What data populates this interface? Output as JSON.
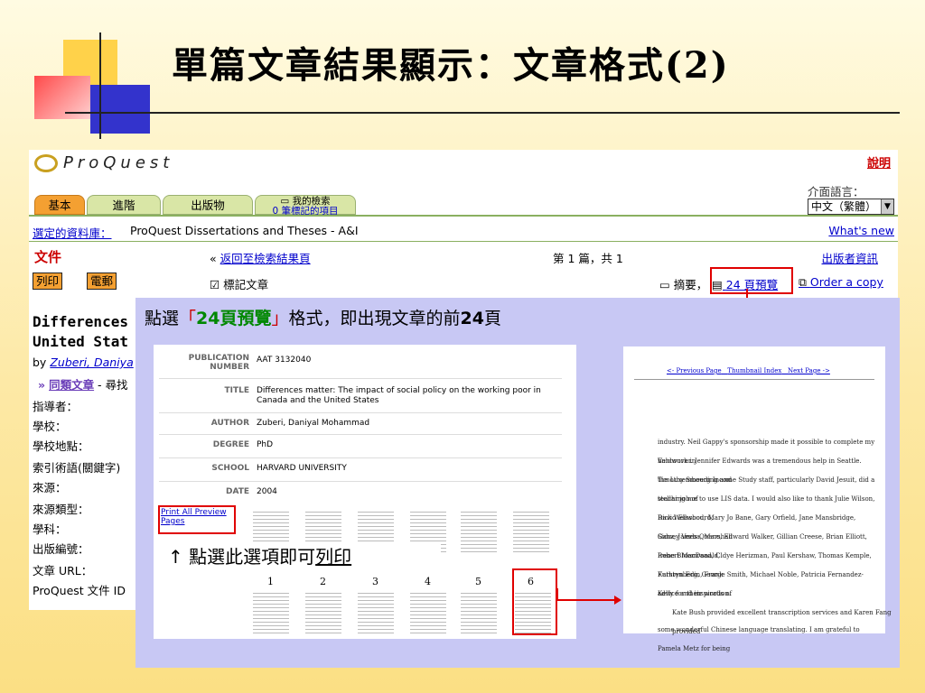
{
  "slide": {
    "title": "單篇文章結果顯示：文章格式(2)"
  },
  "proquest": {
    "logo": "ProQuest",
    "help": "說明",
    "lang_label": "介面語言：",
    "lang_value": "中文（繁體）",
    "tabs": [
      "基本",
      "進階",
      "出版物"
    ],
    "tab_mysearch": "我的檢索",
    "tab_marked": "0 筆標記的項目",
    "db_label": "選定的資料庫：",
    "db_name": "ProQuest Dissertations and Theses - A&I",
    "whats_new": "What's new",
    "doc_heading": "文件",
    "back_prefix": "«",
    "back_link": "返回至檢索結果頁",
    "page_count": "第 1 篇，共 1",
    "publisher_info": "出版者資訊",
    "print_btn": "列印",
    "email_btn": "電郵",
    "mark_article": "☑ 標記文章",
    "fmt_abstract": "摘要，",
    "fmt_24": "24 頁預覽",
    "fmt_order": "Order a copy",
    "article_title_1": "Differences",
    "article_title_2": "United Stat",
    "by_prefix": "by",
    "author_link": "Zuberi, Daniya",
    "similar_prefix": "»",
    "similar_link": "同類文章",
    "similar_suffix": " - 尋找",
    "fields": [
      "指導者：",
      "學校：",
      "學校地點：",
      "索引術語(關鍵字)",
      "來源：",
      "來源類型：",
      "學科：",
      "出版編號：",
      "文章 URL：",
      "ProQuest 文件 ID"
    ]
  },
  "overlay": {
    "instr_pre": "點選",
    "instr_q1": "「",
    "instr_hl": "24頁預覽",
    "instr_q2": "」",
    "instr_mid": "格式，即出現文章的前",
    "instr_num": "24",
    "instr_end": "頁",
    "print_note_pre": "↑ 點選此選項即可",
    "print_note_u": "列印",
    "preview": {
      "rows": [
        {
          "label": "PUBLICATION NUMBER",
          "value": "AAT 3132040"
        },
        {
          "label": "TITLE",
          "value": "Differences matter: The impact of social policy on the working poor in Canada and the United States"
        },
        {
          "label": "AUTHOR",
          "value": "Zuberi, Daniyal Mohammad"
        },
        {
          "label": "DEGREE",
          "value": "PhD"
        },
        {
          "label": "SCHOOL",
          "value": "HARVARD UNIVERSITY"
        },
        {
          "label": "DATE",
          "value": "2004"
        }
      ],
      "print_all": "Print All Preview Pages",
      "thumbs": [
        "1",
        "2",
        "3",
        "4",
        "5",
        "6"
      ]
    },
    "page6": {
      "nav_prev": "<- Previous Page",
      "nav_index": "Thumbnail Index",
      "nav_next": "Next Page ->",
      "lines": [
        "industry.  Neil Gappy's sponsorship made it possible to complete my fieldwork in",
        "Vancouver.  Jennifer Edwards was a tremendous help in Seattle.  Timothy Smeeding and",
        "the Luxembourg Income Study staff, particularly David Jesuit, did a stellar job of",
        "teaching me to use LIS data.  I would also like to thank Julie Wilson, Rick Weissbourd,",
        "David Ellwood, Mary Jo Bane, Gary Orfield, Jane Mansbridge, Sidney Verba, Marshall",
        "Ganz, James Quane, Edward Walker, Gillian Creese, Brian Elliott, Robert MacDonald,",
        "Irene Bloemraad, Cldye Herizman, Paul Kershaw, Thomas Kemple, Kathryn Edin, Frank",
        "Furstenberg, George Smith, Michael Noble, Patricia Fernandez-Kelly for their words of",
        "advice and inspiration.",
        "Kate Bush provided excellent transcription services and Karen Fang provided",
        "some wonderful Chinese language translating.  I am grateful to Pamela Metz for being"
      ]
    }
  }
}
